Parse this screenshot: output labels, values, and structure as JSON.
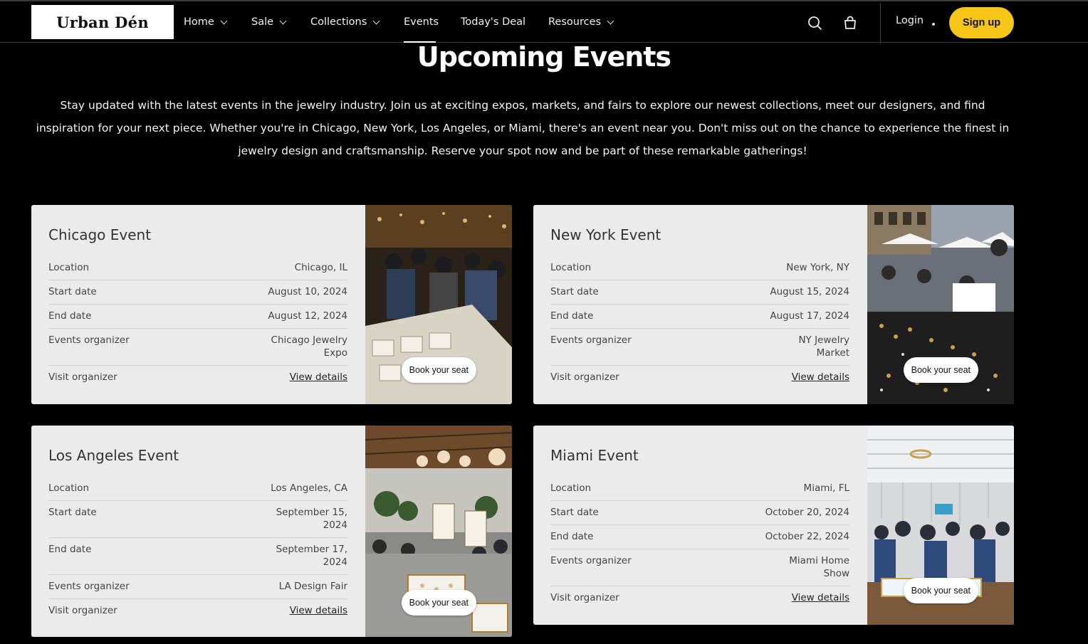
{
  "brand": {
    "logo": "Urban Dén"
  },
  "nav": {
    "home": "Home",
    "sale": "Sale",
    "collections": "Collections",
    "events": "Events",
    "todays_deal": "Today's Deal",
    "resources": "Resources",
    "login": "Login",
    "signup": "Sign up",
    "active": "Events"
  },
  "hero": {
    "title": "Upcoming Events",
    "description": "Stay updated with the latest events in the jewelry industry. Join us at exciting expos, markets, and fairs to explore our newest collections, meet our designers, and find inspiration for your next piece. Whether you're in Chicago, New York, Los Angeles, or Miami, there's an event near you. Don't miss out on the chance to experience the finest in jewelry design and craftsmanship. Reserve your spot now and be part of these remarkable gatherings!"
  },
  "labels": {
    "location": "Location",
    "start_date": "Start date",
    "end_date": "End date",
    "organizer": "Events organizer",
    "visit": "Visit organizer",
    "view_details": "View details",
    "book": "Book your seat"
  },
  "events": [
    {
      "title": "Chicago Event",
      "location": "Chicago, IL",
      "start": "August 10, 2024",
      "end": "August 12, 2024",
      "organizer": "Chicago Jewelry Expo"
    },
    {
      "title": "New York Event",
      "location": "New York, NY",
      "start": "August 15, 2024",
      "end": "August 17, 2024",
      "organizer": "NY Jewelry Market"
    },
    {
      "title": "Los Angeles Event",
      "location": "Los Angeles, CA",
      "start": "September 15, 2024",
      "end": "September 17, 2024",
      "organizer": "LA Design Fair"
    },
    {
      "title": "Miami Event",
      "location": "Miami, FL",
      "start": "October 20, 2024",
      "end": "October 22, 2024",
      "organizer": "Miami Home Show"
    }
  ],
  "colors": {
    "accent": "#f5c518",
    "background": "#000000",
    "card": "#ebebeb"
  }
}
